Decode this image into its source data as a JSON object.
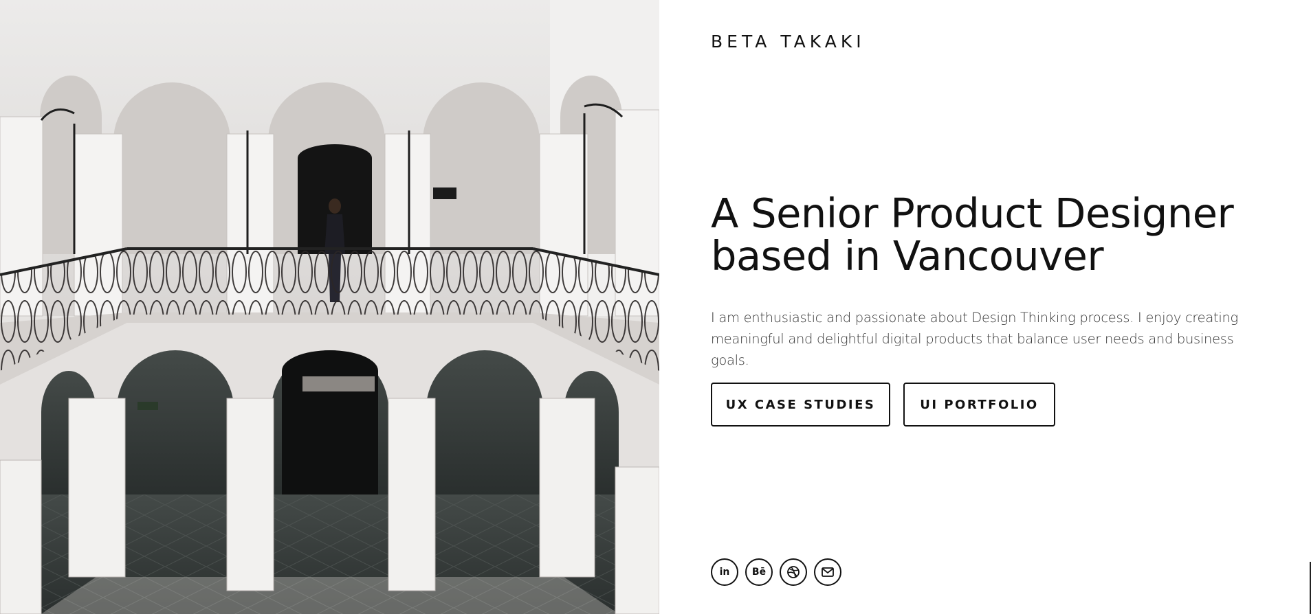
{
  "hero": {
    "photo_icon": "courtyard-photo",
    "site_title": "BETA TAKAKI",
    "headline_line1": "A Senior Product Designer",
    "headline_line2": "based in Vancouver",
    "intro_line1": "I  am enthusiastic and passionate about Design Thinking process. I enjoy creating",
    "intro_line2": "meaningful and delightful digital products that balance user needs and  business goals."
  },
  "buttons": {
    "ux_case_studies": "UX CASE STUDIES",
    "ui_portfolio": "UI PORTFOLIO"
  },
  "social": [
    {
      "icon": "linkedin-icon",
      "label": "in"
    },
    {
      "icon": "behance-icon",
      "label": "Bē"
    },
    {
      "icon": "dribbble-icon",
      "label": ""
    },
    {
      "icon": "mail-icon",
      "label": ""
    }
  ],
  "colors": {
    "text": "#111111",
    "background": "#ffffff",
    "body_text": "#333333"
  }
}
